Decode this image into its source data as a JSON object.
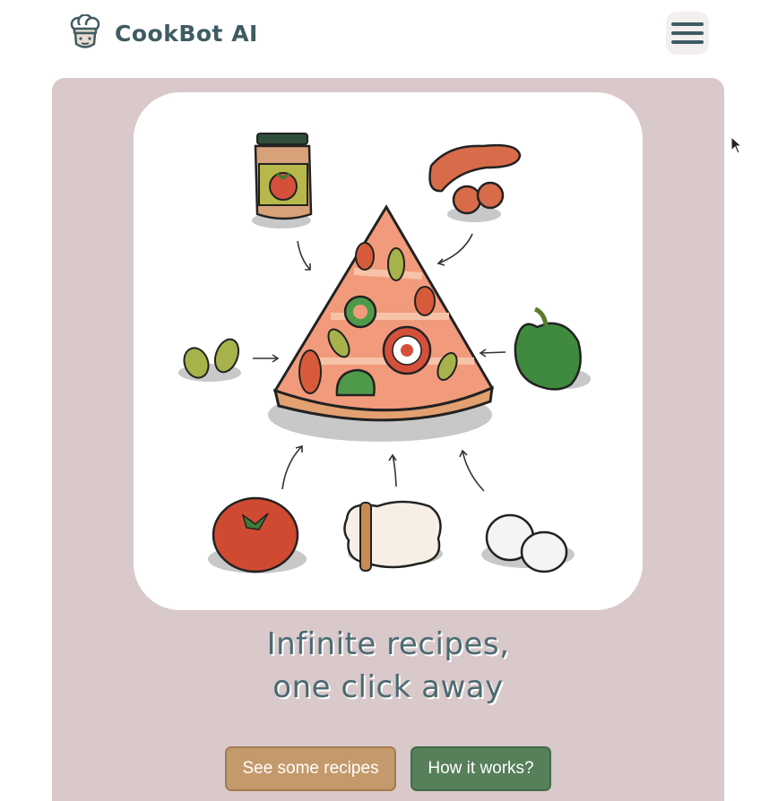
{
  "header": {
    "brand_name": "CookBot AI",
    "logo_icon": "chef-robot-icon",
    "menu_icon": "hamburger-menu-icon"
  },
  "hero": {
    "illustration": "pizza-ingredients-illustration",
    "headline_line1": "Infinite recipes,",
    "headline_line2": "one click away",
    "primary_button_label": "See some recipes",
    "secondary_button_label": "How it works?"
  },
  "colors": {
    "brand_text": "#3f5b63",
    "hero_background": "#d9c9ca",
    "primary_button": "#c49a6c",
    "secondary_button": "#567f5a",
    "headline_text": "#4b6a72"
  }
}
